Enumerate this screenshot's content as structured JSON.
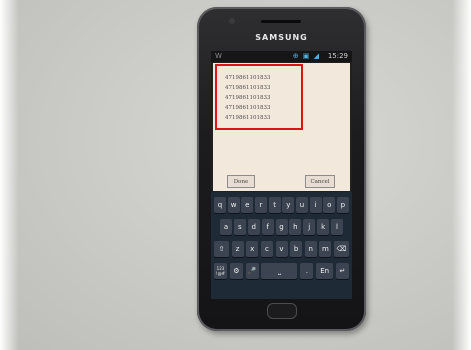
{
  "phone": {
    "brand": "SAMSUNG",
    "status": {
      "left": "W",
      "icons": "⊕ ▣ ◢",
      "time": "15:29"
    }
  },
  "dialog": {
    "lines": [
      "4719861101833",
      "4719861101833",
      "4719861101833",
      "4719861101833",
      "4719861101833"
    ],
    "done_label": "Done",
    "cancel_label": "Cancel"
  },
  "keyboard": {
    "row1": [
      "q",
      "w",
      "e",
      "r",
      "t",
      "y",
      "u",
      "i",
      "o",
      "p"
    ],
    "row2": [
      "a",
      "s",
      "d",
      "f",
      "g",
      "h",
      "j",
      "k",
      "l"
    ],
    "row3": [
      "⇧",
      "z",
      "x",
      "c",
      "v",
      "b",
      "n",
      "m",
      "⌫"
    ],
    "row4": [
      "123\n!@#",
      "⚙",
      "🎤",
      "⎵",
      ".",
      "En",
      "↵"
    ]
  },
  "colors": {
    "highlight": "#e01313",
    "keyboard_bg": "#1f2a37",
    "dialog_bg": "#f3e8dc"
  }
}
